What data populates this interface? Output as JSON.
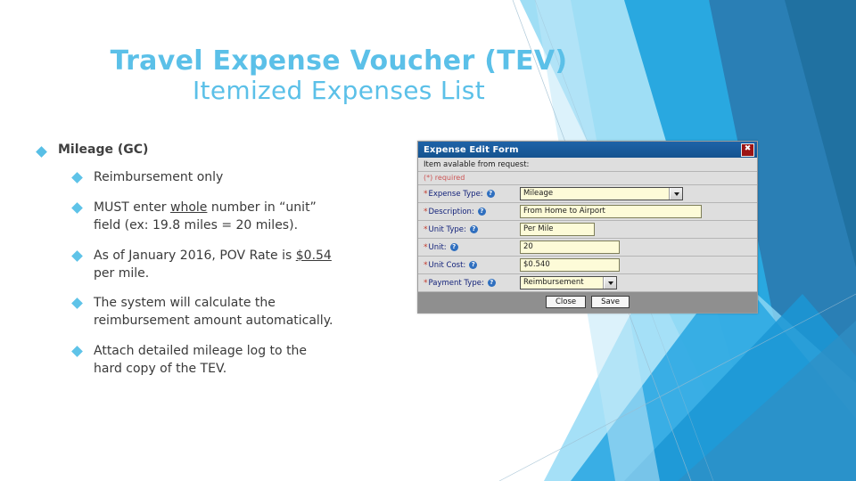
{
  "slide": {
    "title_line1": "Travel Expense Voucher (TEV)",
    "title_line2": "Itemized Expenses List",
    "accent_color": "#5bc0e8"
  },
  "content": {
    "heading": "Mileage (GC)",
    "bullets": [
      {
        "text": "Reimbursement only"
      },
      {
        "pre": "MUST enter ",
        "underline": "whole",
        "post": " number in “unit” field (ex: 19.8 miles = 20 miles)."
      },
      {
        "pre": "As of January 2016, POV Rate is ",
        "underline": "$0.54",
        "post": " per mile."
      },
      {
        "text": "The system will calculate the reimbursement amount automatically."
      },
      {
        "text": "Attach detailed mileage log to the hard copy of the TEV."
      }
    ]
  },
  "form": {
    "title": "Expense Edit Form",
    "close_label": "✖",
    "note": "Item avalable from request:",
    "required_note": "(*) required",
    "required_marker": "*",
    "help_marker": "?",
    "fields": [
      {
        "label": "Expense Type:",
        "value": "Mileage",
        "type": "dropdown"
      },
      {
        "label": "Description:",
        "value": "From Home to Airport",
        "type": "text"
      },
      {
        "label": "Unit Type:",
        "value": "Per Mile",
        "type": "text"
      },
      {
        "label": "Unit:",
        "value": "20",
        "type": "text"
      },
      {
        "label": "Unit Cost:",
        "value": "$0.540",
        "type": "text"
      },
      {
        "label": "Payment Type:",
        "value": "Reimbursement",
        "type": "dropdown"
      }
    ],
    "close_button": "Close",
    "save_button": "Save",
    "titlebar_color": "#1a5c9e",
    "field_bg_color": "#fdfbd8"
  }
}
